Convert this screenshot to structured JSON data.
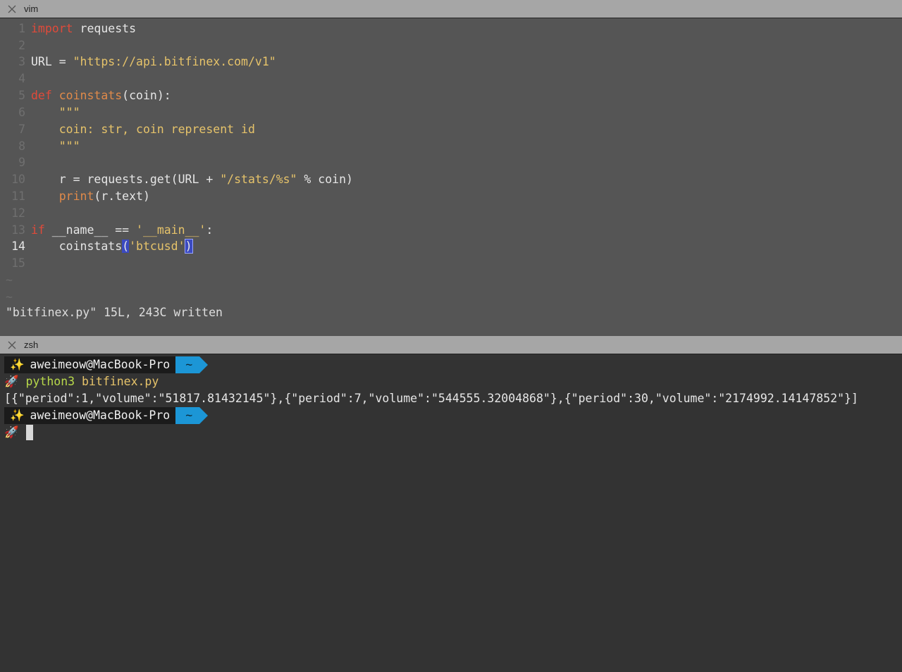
{
  "tabs": {
    "top": "vim",
    "bottom": "zsh"
  },
  "vim": {
    "lines": [
      {
        "num": "1"
      },
      {
        "num": "2"
      },
      {
        "num": "3"
      },
      {
        "num": "4"
      },
      {
        "num": "5"
      },
      {
        "num": "6"
      },
      {
        "num": "7"
      },
      {
        "num": "8"
      },
      {
        "num": "9"
      },
      {
        "num": "10"
      },
      {
        "num": "11"
      },
      {
        "num": "12"
      },
      {
        "num": "13"
      },
      {
        "num": "14"
      },
      {
        "num": "15"
      }
    ],
    "code": {
      "l1_kw": "import",
      "l1_rest": " requests",
      "l3_a": "URL = ",
      "l3_str": "\"https://api.bitfinex.com/v1\"",
      "l5_kw": "def",
      "l5_fn": " coinstats",
      "l5_rest": "(coin):",
      "l6": "    \"\"\"",
      "l7": "    coin: str, coin represent id",
      "l8": "    \"\"\"",
      "l10_a": "    r = requests.get(URL + ",
      "l10_str": "\"/stats/%s\"",
      "l10_b": " % coin)",
      "l11_fn": "    print",
      "l11_rest": "(r.text)",
      "l13_kw": "if",
      "l13_a": " __name__ == ",
      "l13_str": "'__main__'",
      "l13_b": ":",
      "l14_a": "    coinstats",
      "l14_p1": "(",
      "l14_str": "'btcusd'",
      "l14_p2": ")"
    },
    "tilde": "~",
    "status_message": "\"bitfinex.py\" 15L, 243C written"
  },
  "zsh": {
    "prompt_user": "aweimeow@MacBook-Pro",
    "prompt_dir": "~",
    "sparkle_icon": "✨",
    "rocket_icon": "🚀",
    "cmd_python": "python3",
    "cmd_file": " bitfinex.py",
    "output": "[{\"period\":1,\"volume\":\"51817.81432145\"},{\"period\":7,\"volume\":\"544555.32004868\"},{\"period\":30,\"volume\":\"2174992.14147852\"}]"
  }
}
